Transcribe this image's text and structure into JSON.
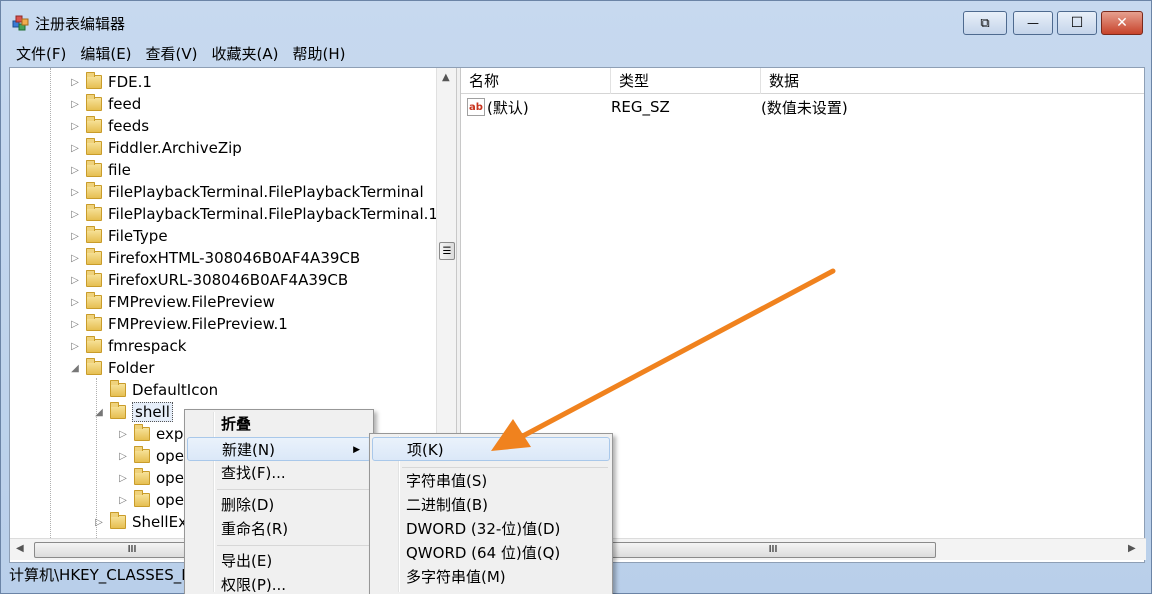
{
  "window": {
    "title": "注册表编辑器",
    "buttons": {
      "restore_glyph": "⧉",
      "minimize_glyph": "—",
      "maximize_glyph": "☐",
      "close_glyph": "✕"
    }
  },
  "menubar": [
    "文件(F)",
    "编辑(E)",
    "查看(V)",
    "收藏夹(A)",
    "帮助(H)"
  ],
  "tree": {
    "items": [
      "FDE.1",
      "feed",
      "feeds",
      "Fiddler.ArchiveZip",
      "file",
      "FilePlaybackTerminal.FilePlaybackTerminal",
      "FilePlaybackTerminal.FilePlaybackTerminal.1",
      "FileType",
      "FirefoxHTML-308046B0AF4A39CB",
      "FirefoxURL-308046B0AF4A39CB",
      "FMPreview.FilePreview",
      "FMPreview.FilePreview.1",
      "fmrespack"
    ],
    "folder": "Folder",
    "default_icon": "DefaultIcon",
    "shell": "shell",
    "shell_children": [
      "exp",
      "ope",
      "ope",
      "ope"
    ],
    "shellex": "ShellEx"
  },
  "list": {
    "headers": [
      "名称",
      "类型",
      "数据"
    ],
    "rows": [
      {
        "name": "(默认)",
        "type": "REG_SZ",
        "data": "(数值未设置)"
      }
    ]
  },
  "status": "计算机\\HKEY_CLASSES_I",
  "context_menu": {
    "items": [
      "折叠",
      "新建(N)",
      "查找(F)...",
      "删除(D)",
      "重命名(R)",
      "导出(E)",
      "权限(P)..."
    ]
  },
  "submenu": {
    "items": [
      "项(K)",
      "字符串值(S)",
      "二进制值(B)",
      "DWORD (32-位)值(D)",
      "QWORD (64 位)值(Q)",
      "多字符串值(M)"
    ]
  },
  "colors": {
    "annotation_arrow": "#f0821e",
    "highlight": "#dbe8f8"
  },
  "scroll_grip": "III",
  "scroll_grip_v": "☰"
}
